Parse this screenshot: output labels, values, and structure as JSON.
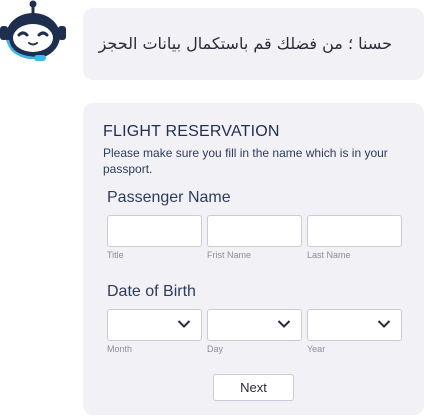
{
  "chat": {
    "bot_icon": "robot-icon",
    "message": "حسنا ؛ من فضلك قم باستكمال بيانات الحجز"
  },
  "form": {
    "title": "FLIGHT RESERVATION",
    "subtitle": "Please make sure you fill in the name which is in your passport.",
    "passenger_section": {
      "label": "Passenger Name",
      "fields": [
        {
          "hint": "Title",
          "value": ""
        },
        {
          "hint": "Frist Name",
          "value": ""
        },
        {
          "hint": "Last Name",
          "value": ""
        }
      ]
    },
    "dob_section": {
      "label": "Date of Birth",
      "selects": [
        {
          "hint": "Month",
          "value": "",
          "icon": "chevron-down-icon"
        },
        {
          "hint": "Day",
          "value": "",
          "icon": "chevron-down-icon"
        },
        {
          "hint": "Year",
          "value": "",
          "icon": "chevron-down-icon"
        }
      ]
    },
    "next_label": "Next"
  },
  "colors": {
    "card_bg": "#f1f1f6",
    "title_color": "#1f2f52",
    "bot_dark": "#1d2e4f",
    "bot_accent": "#3db8e8"
  }
}
